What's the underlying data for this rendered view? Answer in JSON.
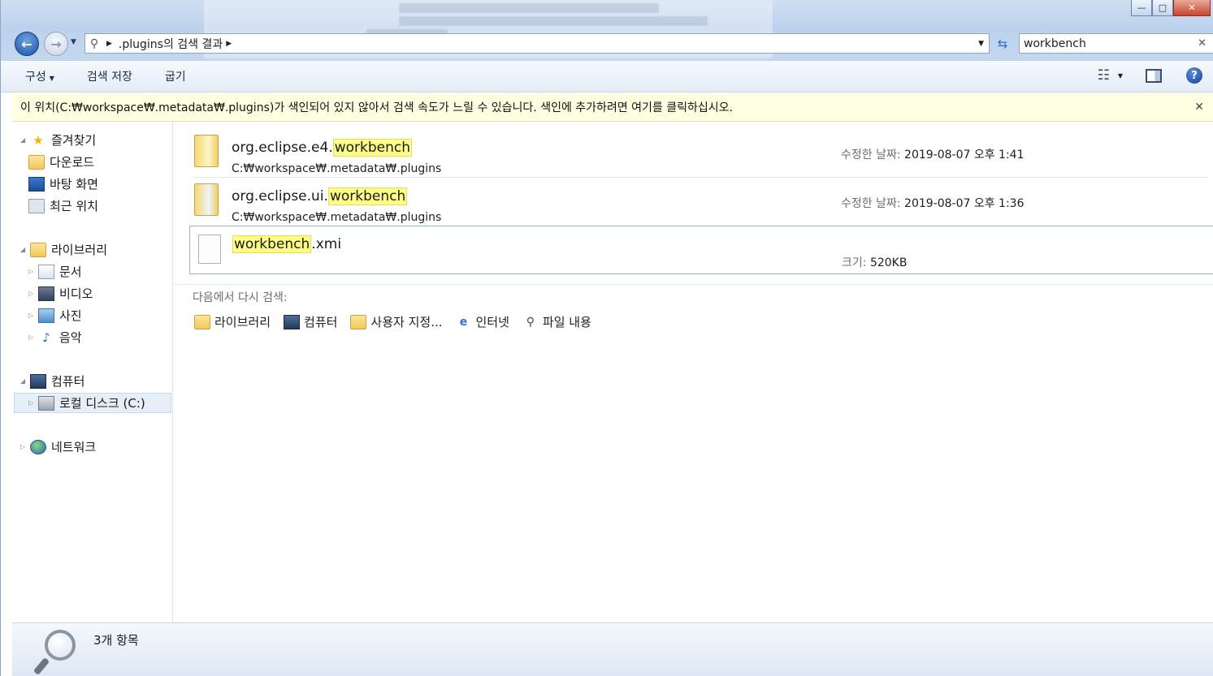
{
  "window": {
    "controls": {
      "minimize": "—",
      "maximize": "□",
      "close": "✕"
    }
  },
  "address": {
    "path_segment": ".plugins의 검색 결과"
  },
  "search": {
    "value": "workbench",
    "clear_glyph": "✕"
  },
  "toolbar": {
    "organize": "구성",
    "save_search": "검색 저장",
    "burn": "굽기"
  },
  "infobar": {
    "message": "이 위치(C:₩workspace₩.metadata₩.plugins)가 색인되어 있지 않아서 검색 속도가 느릴 수 있습니다. 색인에 추가하려면 여기를 클릭하십시오.",
    "close_glyph": "✕"
  },
  "nav": {
    "favorites": "즐겨찾기",
    "downloads": "다운로드",
    "desktop": "바탕 화면",
    "recent": "최근 위치",
    "libraries": "라이브러리",
    "documents": "문서",
    "videos": "비디오",
    "pictures": "사진",
    "music": "음악",
    "computer": "컴퓨터",
    "local_disk": "로컬 디스크 (C:)",
    "network": "네트워크"
  },
  "results": [
    {
      "name_prefix": "org.eclipse.e4.",
      "name_match": "workbench",
      "name_suffix": "",
      "path": "C:₩workspace₩.metadata₩.plugins",
      "meta_label": "수정한 날짜:",
      "meta_value": "2019-08-07 오후 1:41"
    },
    {
      "name_prefix": "org.eclipse.ui.",
      "name_match": "workbench",
      "name_suffix": "",
      "path": "C:₩workspace₩.metadata₩.plugins",
      "meta_label": "수정한 날짜:",
      "meta_value": "2019-08-07 오후 1:36"
    },
    {
      "name_prefix": "",
      "name_match": "workbench",
      "name_suffix": ".xmi",
      "path": "",
      "meta_label": "크기:",
      "meta_value": "520KB"
    }
  ],
  "search_again": {
    "label": "다음에서 다시 검색:",
    "items": [
      "라이브러리",
      "컴퓨터",
      "사용자 지정...",
      "인터넷",
      "파일 내용"
    ]
  },
  "details": {
    "count": "3개 항목"
  },
  "colors": {
    "highlight": "#ffff85",
    "infobar_bg": "#ffffe1",
    "selection_border": "#99b4d6"
  }
}
